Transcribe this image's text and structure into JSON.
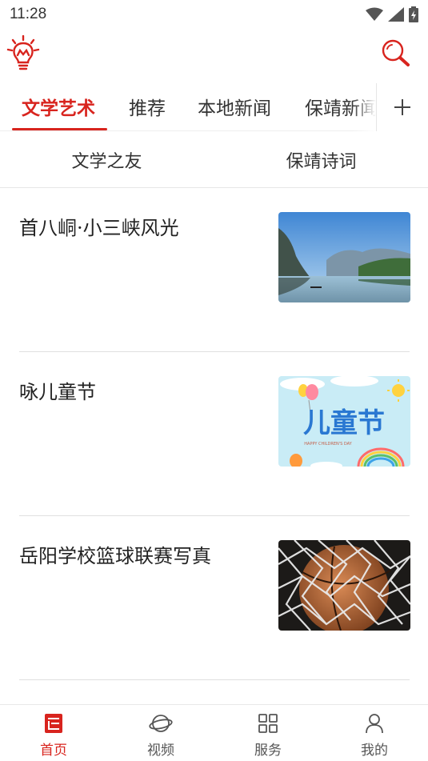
{
  "status_bar": {
    "time": "11:28"
  },
  "header": {
    "logo_icon": "lightbulb-logo-icon",
    "search_icon": "search-icon"
  },
  "channel_tabs": {
    "items": [
      "文学艺术",
      "推荐",
      "本地新闻",
      "保靖新闻"
    ],
    "active_index": 0,
    "add_icon": "plus-icon"
  },
  "sub_tabs": {
    "items": [
      "文学之友",
      "保靖诗词"
    ]
  },
  "articles": [
    {
      "title": "首八峒·小三峡风光",
      "thumb": "landscape-lake-photo"
    },
    {
      "title": "咏儿童节",
      "thumb": "childrens-day-poster"
    },
    {
      "title": "岳阳学校篮球联赛写真",
      "thumb": "basketball-net-photo"
    }
  ],
  "poster_text": {
    "main": "儿童节",
    "sub": "HAPPY CHILDREN'S DAY"
  },
  "bottom_nav": {
    "items": [
      {
        "label": "首页",
        "icon": "home-icon"
      },
      {
        "label": "视频",
        "icon": "video-planet-icon"
      },
      {
        "label": "服务",
        "icon": "services-grid-icon"
      },
      {
        "label": "我的",
        "icon": "profile-icon"
      }
    ],
    "active_index": 0
  },
  "colors": {
    "accent": "#d8241e",
    "text": "#222222",
    "muted": "#555555"
  }
}
